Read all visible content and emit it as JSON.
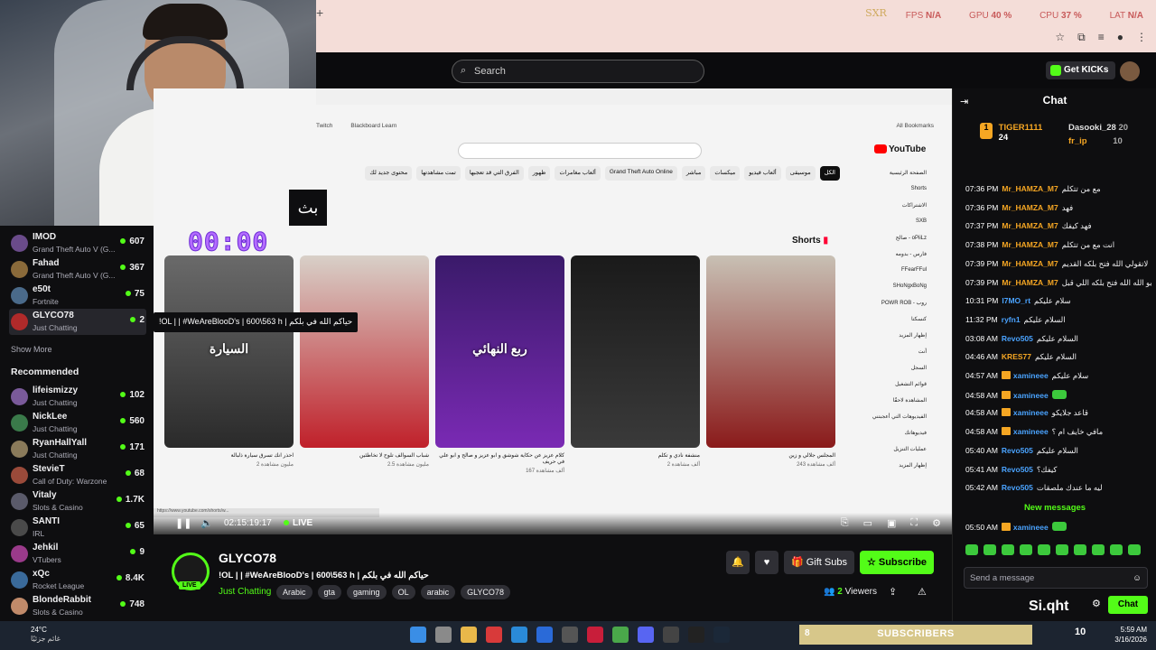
{
  "browser": {
    "new_tab": "+",
    "perf": {
      "fps_label": "FPS",
      "fps_value": "N/A",
      "gpu_label": "GPU",
      "gpu_value": "40 %",
      "cpu_label": "CPU",
      "cpu_value": "37 %",
      "lat_label": "LAT",
      "lat_value": "N/A"
    }
  },
  "overlay": {
    "timer": "00:00",
    "box_text": "بث"
  },
  "header": {
    "search_placeholder": "Search",
    "get_kicks": "Get KICKs"
  },
  "sidebar": {
    "following": [
      {
        "name": "IMOD",
        "category": "Grand Theft Auto V (G...",
        "viewers": "607",
        "color": "#6a4b8a"
      },
      {
        "name": "Fahad",
        "category": "Grand Theft Auto V (G...",
        "viewers": "367",
        "color": "#8a6a3a"
      },
      {
        "name": "e50t",
        "category": "Fortnite",
        "viewers": "75",
        "color": "#4a6a8a"
      },
      {
        "name": "GLYCO78",
        "category": "Just Chatting",
        "viewers": "2",
        "color": "#b02a2a"
      }
    ],
    "show_more": "Show More",
    "recommended_title": "Recommended",
    "recommended": [
      {
        "name": "lifeismizzy",
        "category": "Just Chatting",
        "viewers": "102",
        "color": "#7a5a9a"
      },
      {
        "name": "NickLee",
        "category": "Just Chatting",
        "viewers": "560",
        "color": "#3a7a4a"
      },
      {
        "name": "RyanHallYall",
        "category": "Just Chatting",
        "viewers": "171",
        "color": "#8a7a5a"
      },
      {
        "name": "StevieT",
        "category": "Call of Duty: Warzone",
        "viewers": "68",
        "color": "#9a4a3a"
      },
      {
        "name": "Vitaly",
        "category": "Slots & Casino",
        "viewers": "1.7K",
        "color": "#5a5a6a"
      },
      {
        "name": "SANTI",
        "category": "IRL",
        "viewers": "65",
        "color": "#4a4a4a"
      },
      {
        "name": "Jehkil",
        "category": "VTubers",
        "viewers": "9",
        "color": "#9a3a8a"
      },
      {
        "name": "xQc",
        "category": "Rocket League",
        "viewers": "8.4K",
        "color": "#3a6a9a"
      },
      {
        "name": "BlondeRabbit",
        "category": "Slots & Casino",
        "viewers": "748",
        "color": "#c08a6a"
      }
    ]
  },
  "youtube": {
    "bookmarks": [
      "Twitch",
      "Blackboard Learn",
      "All Bookmarks"
    ],
    "chips": [
      "محتوى جديد لك",
      "تمت مشاهدتها",
      "الفرق التي قد تعجبها",
      "ظهور",
      "ألعاب مغامرات",
      "Grand Theft Auto Online",
      "مباشر",
      "ميكسات",
      "ألعاب فيديو",
      "موسيقى",
      "الكل"
    ],
    "logo": "YouTube",
    "shorts_title": "Shorts",
    "sidebar_items": [
      "الصفحة الرئيسية",
      "Shorts",
      "الاشتراكات",
      "SXB",
      "صالح - oPiiLz",
      "فارس - بدومه",
      "FFearFFul",
      "SHoNgxBoNg",
      "POWR ROB - روب",
      "كنسكتا",
      "إظهار المزيد",
      "أنت",
      "السجل",
      "قوائم التشغيل",
      "المشاهدة لاحقًا",
      "الفيديوهات التي أعجبتني",
      "فيديوهاتك",
      "عمليات التنزيل",
      "إظهار المزيد"
    ],
    "shorts": [
      {
        "caption": "احذر انك تسرق سيارة ذلبالة",
        "views": "2 مليون مشاهدة",
        "c1": "#6a6a6a",
        "c2": "#2a2a2a",
        "label": "السيارة"
      },
      {
        "caption": "شباب السوالف تلوح لا تخاطئين",
        "views": "2.5 مليون مشاهدة",
        "c1": "#d8d0c8",
        "c2": "#c0202a",
        "label": ""
      },
      {
        "caption": "كلام عزيز عن حكاية شوشق و ابو عزيز و صالح و ابو علي في حريف",
        "views": "167 ألف مشاهدة",
        "c1": "#3a1a6a",
        "c2": "#7a2ab4",
        "label": "ربع النهائي"
      },
      {
        "caption": "منشفة نادي و تكلم",
        "views": "2 ألف مشاهدة",
        "c1": "#1a1a1a",
        "c2": "#3a3a3a",
        "label": ""
      },
      {
        "caption": "المجلس جلالي و زين",
        "views": "243 ألف مشاهدة",
        "c1": "#c8c0b4",
        "c2": "#8a1a1a",
        "label": ""
      }
    ],
    "status_url": "https://www.youtube.com/shorts/w..."
  },
  "player": {
    "time": "02:15:19:17",
    "live_label": "LIVE",
    "tooltip": "!OL | | #WeAreBlooD's | 600\\563 h | حياكم الله في بلكم"
  },
  "stream": {
    "channel": "GLYCO78",
    "title": "!OL | | #WeAreBlooD's | 600\\563 h | حياكم الله في بلكم",
    "category": "Just Chatting",
    "tags": [
      "Arabic",
      "gta",
      "gaming",
      "OL",
      "arabic",
      "GLYCO78"
    ],
    "viewers_count": "2",
    "viewers_label": "Viewers",
    "gift_subs": "Gift Subs",
    "subscribe": "Subscribe",
    "live_badge": "LIVE"
  },
  "chat": {
    "title": "Chat",
    "gifters": [
      {
        "name": "TIGER1111",
        "count": "24",
        "color": "#f5a623"
      },
      {
        "name": "Dasooki_28",
        "count": "20",
        "color": "#e0e0e0"
      },
      {
        "name": "fr_ip",
        "count": "10",
        "color": "#f5a623"
      }
    ],
    "messages": [
      {
        "time": "07:36 PM",
        "user": "Mr_HAMZA_M7",
        "color": "#f5a623",
        "text": "مع من تتكلم",
        "badge": false
      },
      {
        "time": "07:36 PM",
        "user": "Mr_HAMZA_M7",
        "color": "#f5a623",
        "text": "فهد",
        "badge": false
      },
      {
        "time": "07:37 PM",
        "user": "Mr_HAMZA_M7",
        "color": "#f5a623",
        "text": "فهد كيفك",
        "badge": false
      },
      {
        "time": "07:38 PM",
        "user": "Mr_HAMZA_M7",
        "color": "#f5a623",
        "text": "انت مع من تتكلم",
        "badge": false
      },
      {
        "time": "07:39 PM",
        "user": "Mr_HAMZA_M7",
        "color": "#f5a623",
        "text": "لاتقولي الله فتح بلكه القديم",
        "badge": false
      },
      {
        "time": "07:39 PM",
        "user": "Mr_HAMZA_M7",
        "color": "#f5a623",
        "text": "ابو الله الله فتح بلكه اللي قبل",
        "badge": false
      },
      {
        "time": "10:31 PM",
        "user": "I7MO_rt",
        "color": "#4aa3ff",
        "text": "سلام عليكم",
        "badge": false
      },
      {
        "time": "11:32 PM",
        "user": "ryfn1",
        "color": "#4aa3ff",
        "text": "السلام عليكم",
        "badge": false
      },
      {
        "time": "03:08 AM",
        "user": "Revo505",
        "color": "#4aa3ff",
        "text": "السلام عليكم",
        "badge": false
      },
      {
        "time": "04:46 AM",
        "user": "KRES77",
        "color": "#f5a623",
        "text": "السلام عليكم",
        "badge": false
      },
      {
        "time": "04:57 AM",
        "user": "xamineee",
        "color": "#4aa3ff",
        "text": "سلام عليكم",
        "badge": true
      },
      {
        "time": "04:58 AM",
        "user": "xamineee",
        "color": "#4aa3ff",
        "text": "",
        "badge": true
      },
      {
        "time": "04:58 AM",
        "user": "xamineee",
        "color": "#4aa3ff",
        "text": "قاعد جلايكو",
        "badge": true
      },
      {
        "time": "04:58 AM",
        "user": "xamineee",
        "color": "#4aa3ff",
        "text": "مافي خايف ام ؟",
        "badge": true
      },
      {
        "time": "05:40 AM",
        "user": "Revo505",
        "color": "#4aa3ff",
        "text": "السلام عليكم",
        "badge": false
      },
      {
        "time": "05:41 AM",
        "user": "Revo505",
        "color": "#4aa3ff",
        "text": "كيفك؟",
        "badge": false
      },
      {
        "time": "05:42 AM",
        "user": "Revo505",
        "color": "#4aa3ff",
        "text": "ليه ما عندك ملصقات",
        "badge": false
      }
    ],
    "new_messages": "New messages",
    "last_message": {
      "time": "05:50 AM",
      "user": "xamineee",
      "color": "#4aa3ff",
      "text": "",
      "badge": true
    },
    "placeholder": "Send a message",
    "send_label": "Chat",
    "watermark": "Si.qht"
  },
  "taskbar": {
    "weather_temp": "24°C",
    "weather_text": "غائم جزئيًا",
    "subs_count": "8",
    "subs_label": "SUBSCRIBERS",
    "ten": "10",
    "time": "5:59 AM",
    "date": "3/16/2026"
  }
}
